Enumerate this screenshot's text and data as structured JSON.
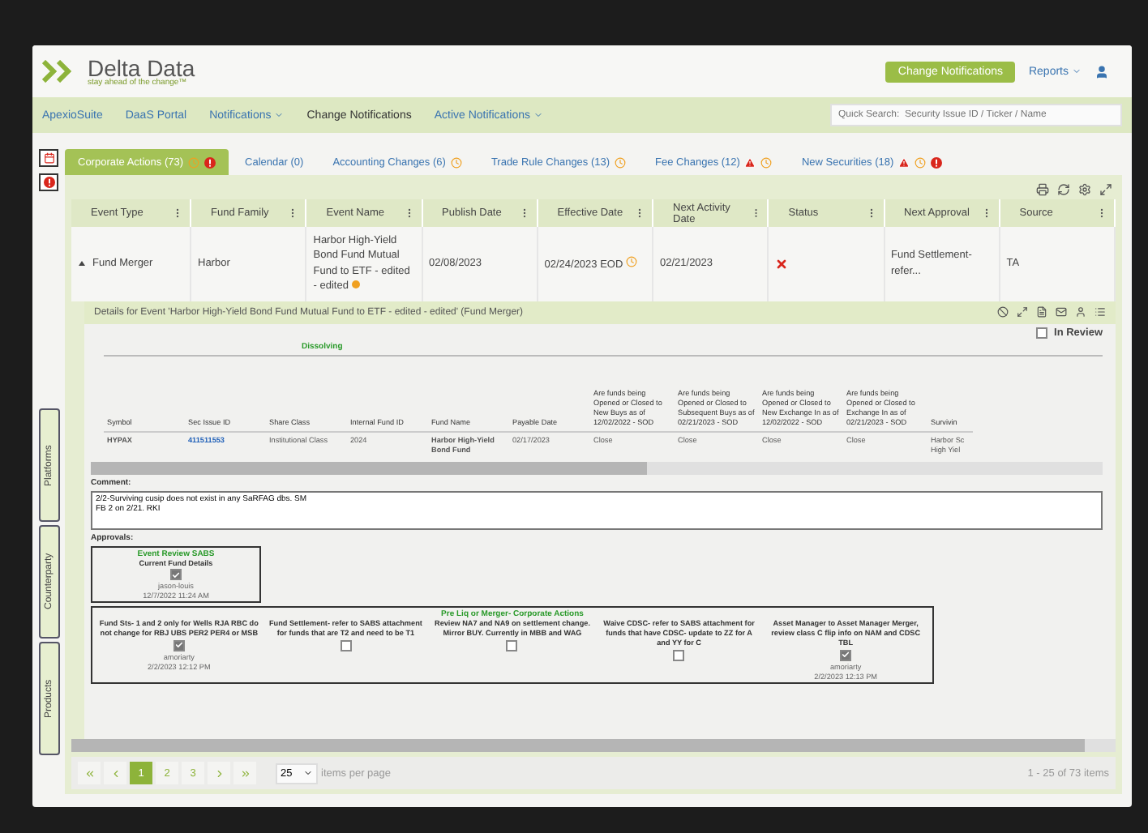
{
  "header": {
    "brand": "Delta Data",
    "tagline": "stay ahead of the change™",
    "button": "Change Notifications",
    "menus": [
      "Reports"
    ]
  },
  "nav": {
    "items": [
      {
        "label": "ApexioSuite",
        "dropdown": false,
        "current": false
      },
      {
        "label": "DaaS Portal",
        "dropdown": false,
        "current": false
      },
      {
        "label": "Notifications",
        "dropdown": true,
        "current": false
      },
      {
        "label": "Change Notifications",
        "dropdown": false,
        "current": true
      },
      {
        "label": "Active Notifications",
        "dropdown": true,
        "current": false
      }
    ],
    "search": {
      "placeholder": "Quick Search:  Security Issue ID / Ticker / Name"
    }
  },
  "side_tabs": [
    "Platforms",
    "Counterparty",
    "Products"
  ],
  "tabs": [
    {
      "label": "Corporate Actions (73)",
      "selected": true,
      "warning": false,
      "clock": true,
      "error": true
    },
    {
      "label": "Calendar (0)",
      "selected": false,
      "warning": false,
      "clock": false,
      "error": false
    },
    {
      "label": "Accounting Changes (6)",
      "selected": false,
      "warning": false,
      "clock": true,
      "error": false
    },
    {
      "label": "Trade Rule Changes (13)",
      "selected": false,
      "warning": false,
      "clock": true,
      "error": false
    },
    {
      "label": "Fee Changes (12)",
      "selected": false,
      "warning": true,
      "clock": true,
      "error": false
    },
    {
      "label": "New Securities (18)",
      "selected": false,
      "warning": true,
      "clock": true,
      "error": true
    }
  ],
  "table": {
    "columns": [
      "Event Type",
      "Fund Family",
      "Event Name",
      "Publish Date",
      "Effective Date",
      "Next Activity Date",
      "Status",
      "Next Approval",
      "Source"
    ],
    "rows": [
      {
        "expanded": true,
        "cells": [
          {
            "text": "Fund Merger"
          },
          {
            "text": "Harbor"
          },
          {
            "text": "Harbor High-Yield Bond Fund Mutual Fund to ETF - edited - edited",
            "dot": true
          },
          {
            "text": "02/08/2023"
          },
          {
            "text": "02/24/2023 EOD",
            "clock": true
          },
          {
            "text": "02/21/2023"
          },
          {
            "cross": true
          },
          {
            "text": "Fund Settlement- refer..."
          },
          {
            "text": "TA"
          }
        ]
      }
    ]
  },
  "details": {
    "title": "Details for Event 'Harbor High-Yield Bond Fund Mutual Fund to ETF - edited - edited' (Fund Merger)",
    "in_review": {
      "label": "In Review",
      "checked": false
    },
    "group_label": "Dissolving",
    "columns": [
      "Symbol",
      "Sec Issue ID",
      "Share Class",
      "Internal Fund ID",
      "Fund Name",
      "Payable Date",
      "Are funds being Opened or Closed to New Buys as of 12/02/2022 - SOD",
      "Are funds being Opened or Closed to Subsequent Buys as of 02/21/2023 - SOD",
      "Are funds being Opened or Closed to New Exchange In as of 12/02/2022 - SOD",
      "Are funds being Opened or Closed to Exchange In as of 02/21/2023 - SOD",
      "Survivin"
    ],
    "rows": [
      [
        {
          "text": "HYPAX",
          "kind": "bold"
        },
        {
          "text": "411511553",
          "kind": "link"
        },
        {
          "text": "Institutional Class",
          "kind": "plain"
        },
        {
          "text": "2024",
          "kind": "plain"
        },
        {
          "text": "Harbor High-Yield Bond Fund",
          "kind": "bold"
        },
        {
          "text": "02/17/2023",
          "kind": "plain"
        },
        {
          "text": "Close",
          "kind": "plain"
        },
        {
          "text": "Close",
          "kind": "plain"
        },
        {
          "text": "Close",
          "kind": "plain"
        },
        {
          "text": "Close",
          "kind": "plain"
        },
        {
          "text": "Harbor Sc High Yiel",
          "kind": "plain"
        }
      ]
    ],
    "comment_label": "Comment:",
    "comment": "2/2-Surviving cusip does not exist in any SaRFAG dbs. SM\nFB 2 on 2/21. RKI",
    "approvals_label": "Approvals:",
    "approval_groups": [
      {
        "title": "Event Review SABS",
        "items": [
          {
            "label": "Current Fund Details",
            "checked": true,
            "user": "jason-louis",
            "time": "12/7/2022 11:24 AM"
          }
        ]
      },
      {
        "title": "Pre Liq or Merger- Corporate Actions",
        "items": [
          {
            "label": "Fund Sts- 1 and 2 only for Wells RJA RBC do not change for RBJ UBS PER2 PER4 or MSB",
            "checked": true,
            "user": "amoriarty",
            "time": "2/2/2023 12:12 PM"
          },
          {
            "label": "Fund Settlement- refer to SABS attachment for funds that are T2 and need to be T1",
            "checked": false
          },
          {
            "label": "Review NA7 and NA9 on settlement change. Mirror BUY. Currently in MBB and WAG",
            "checked": false
          },
          {
            "label": "Waive CDSC- refer to SABS attachment for funds that have CDSC- update to ZZ for A and YY for C",
            "checked": false
          },
          {
            "label": "Asset Manager to Asset Manager Merger, review class C flip info on NAM and CDSC TBL",
            "checked": true,
            "user": "amoriarty",
            "time": "2/2/2023 12:13 PM"
          }
        ]
      }
    ]
  },
  "pager": {
    "pages": [
      {
        "label": "1",
        "selected": true
      },
      {
        "label": "2",
        "selected": false
      },
      {
        "label": "3",
        "selected": false
      }
    ],
    "page_size": "25",
    "page_size_label": "items per page",
    "summary": "1 - 25 of 73 items"
  }
}
